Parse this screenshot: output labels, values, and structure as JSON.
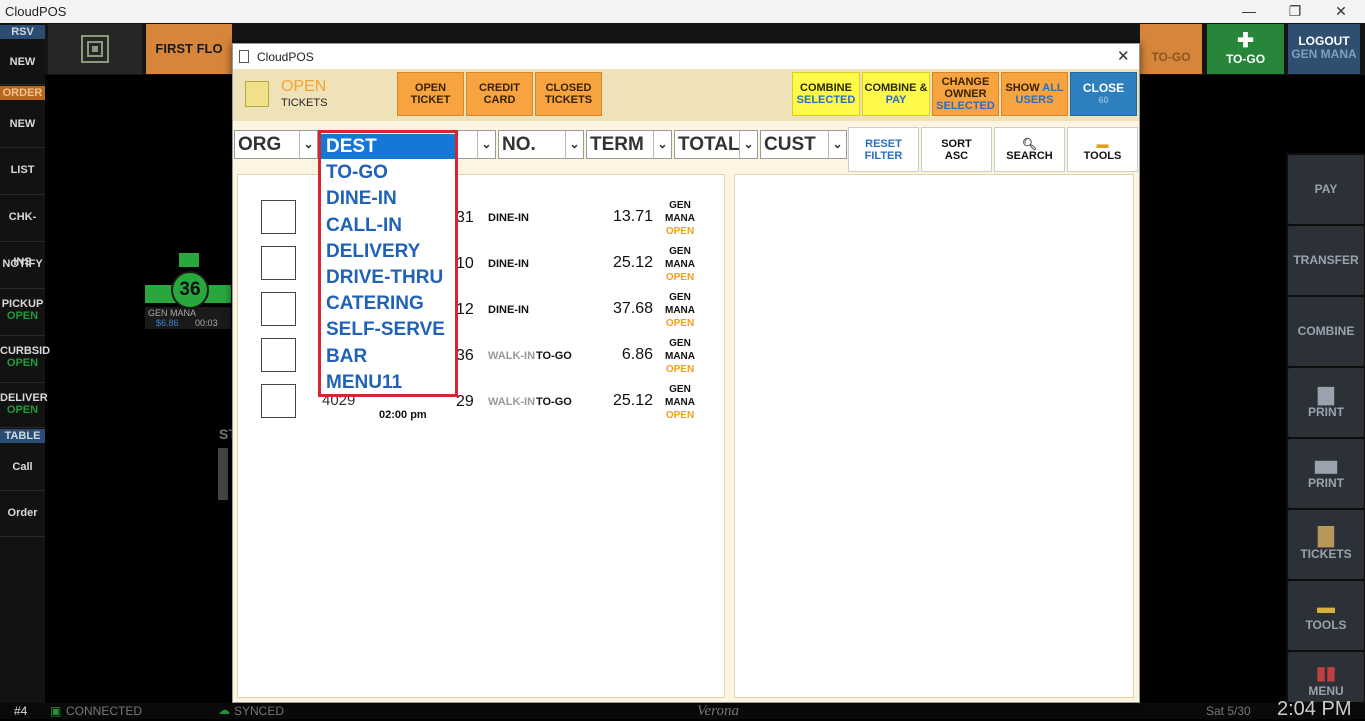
{
  "window": {
    "title": "CloudPOS",
    "minimize": "—",
    "restore": "❐",
    "close": "✕"
  },
  "topbar": {
    "first_floor": "FIRST FLO",
    "togo_small": "TO-GO",
    "togo_big": "TO-GO",
    "logout": "LOGOUT",
    "logout_user": "GEN MANA"
  },
  "leftbar": {
    "rsv": "RSV",
    "new1": "NEW",
    "order": "ORDER",
    "new2": "NEW",
    "list": "LIST",
    "chkins": "CHK-INS",
    "notify": "NOTIFY",
    "pickup": "PICKUP",
    "pickup_status": "OPEN",
    "curbside": "CURBSID",
    "curbside_status": "OPEN",
    "delivery": "DELIVER",
    "delivery_status": "OPEN",
    "table": "TABLE",
    "call": "Call",
    "order_btn": "Order"
  },
  "background": {
    "table_number": "36",
    "table_user": "GEN MANA",
    "table_amount": "$6.86",
    "table_time": "00:03",
    "floor_partial": "ST"
  },
  "rightbar": {
    "pay": "PAY",
    "transfer": "TRANSFER",
    "combine": "COMBINE",
    "print1": "PRINT",
    "print2": "PRINT",
    "tickets": "TICKETS",
    "tools": "TOOLS",
    "menu": "MENU"
  },
  "statusbar": {
    "terminal": "#4",
    "connected": "CONNECTED",
    "synced": "SYNCED",
    "location": "Verona",
    "date": "Sat 5/30",
    "time": "2:04 PM"
  },
  "dialog": {
    "title": "CloudPOS",
    "close_x": "✕",
    "header": {
      "open": "OPEN",
      "tickets": "TICKETS",
      "open_ticket": [
        "OPEN",
        "TICKET"
      ],
      "credit_card": [
        "CREDIT",
        "CARD"
      ],
      "closed_tickets": [
        "CLOSED",
        "TICKETS"
      ],
      "combine_selected": [
        "COMBINE",
        "SELECTED"
      ],
      "combine_pay": [
        "COMBINE &",
        "PAY"
      ],
      "change_owner": [
        "CHANGE",
        "OWNER",
        "SELECTED"
      ],
      "show_all_users": [
        "SHOW",
        "ALL",
        "USERS"
      ],
      "close": [
        "CLOSE",
        "60"
      ]
    },
    "filters": {
      "org": "ORG",
      "no": "NO.",
      "term": "TERM",
      "total": "TOTAL",
      "cust": "CUST",
      "reset_filter": [
        "RESET",
        "FILTER"
      ],
      "sort_asc": [
        "SORT",
        "ASC"
      ],
      "search": "SEARCH",
      "tools": "TOOLS"
    },
    "dropdown_options": [
      "DEST",
      "TO-GO",
      "DINE-IN",
      "CALL-IN",
      "DELIVERY",
      "DRIVE-THRU",
      "CATERING",
      "SELF-SERVE",
      "BAR",
      "MENU11"
    ],
    "tickets": [
      {
        "term": "31",
        "dest": "",
        "type": "DINE-IN",
        "total": "13.71",
        "owner1": "GEN",
        "owner2": "MANA",
        "status": "OPEN"
      },
      {
        "term": "10",
        "dest": "",
        "type": "DINE-IN",
        "total": "25.12",
        "owner1": "GEN",
        "owner2": "MANA",
        "status": "OPEN"
      },
      {
        "term": "12",
        "dest": "",
        "type": "DINE-IN",
        "total": "37.68",
        "owner1": "GEN",
        "owner2": "MANA",
        "status": "OPEN"
      },
      {
        "term": "36",
        "dest": "WALK-IN",
        "type": "TO-GO",
        "total": "6.86",
        "owner1": "GEN",
        "owner2": "MANA",
        "status": "OPEN"
      },
      {
        "term": "29",
        "dest": "WALK-IN",
        "type": "TO-GO",
        "total": "25.12",
        "owner1": "GEN",
        "owner2": "MANA",
        "status": "OPEN",
        "number": "4029",
        "time": "02:00 pm"
      }
    ]
  }
}
